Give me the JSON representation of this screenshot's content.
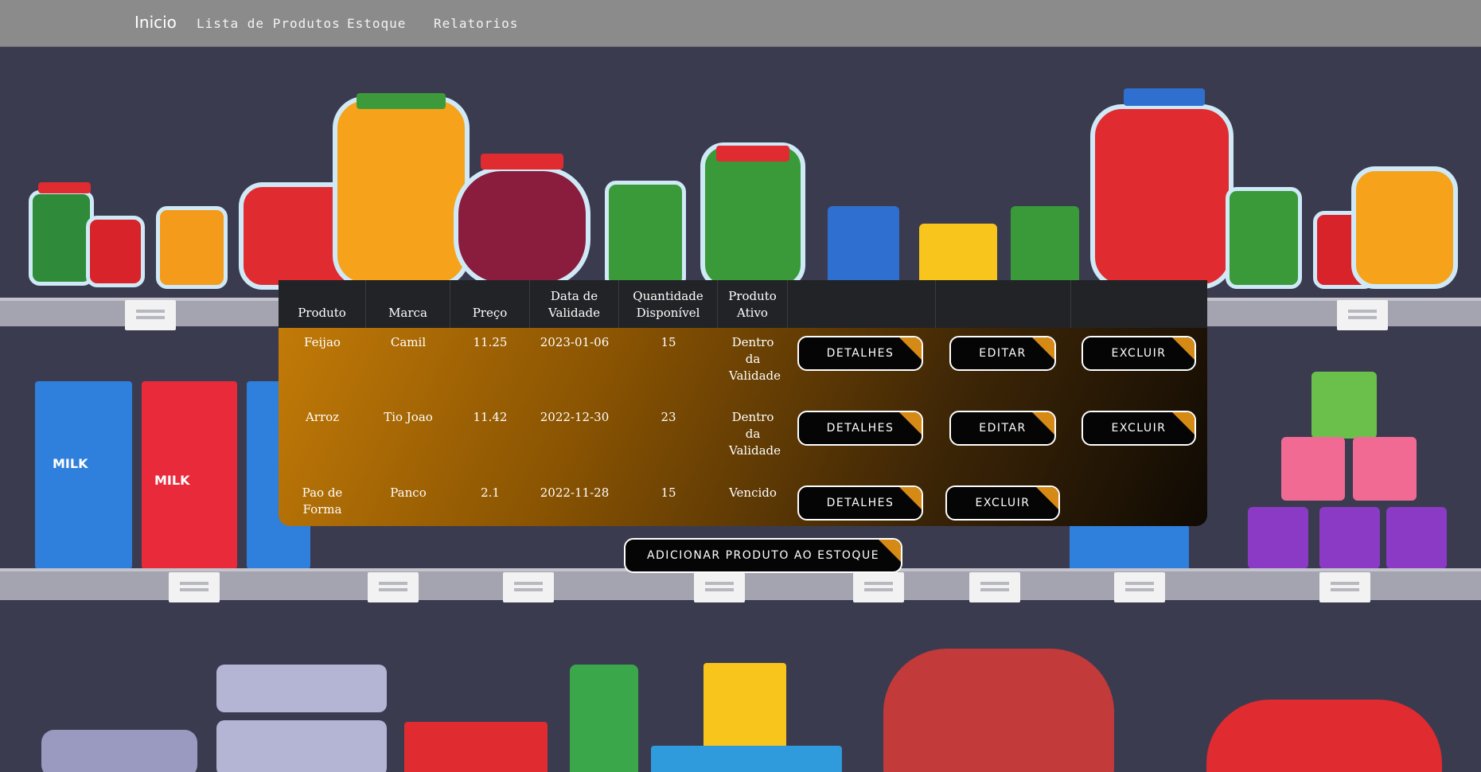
{
  "nav": {
    "brand": "Inicio",
    "links": [
      "Lista de Produtos",
      "Estoque",
      "Relatorios"
    ]
  },
  "table": {
    "headers": [
      "Produto",
      "Marca",
      "Preço",
      "Data de Validade",
      "Quantidade Disponível",
      "Produto Ativo"
    ],
    "rows": [
      {
        "produto": "Feijao",
        "marca": "Camil",
        "preco": "11.25",
        "validade": "2023-01-06",
        "quantidade": "15",
        "status": "Dentro da Validade"
      },
      {
        "produto": "Arroz",
        "marca": "Tio Joao",
        "preco": "11.42",
        "validade": "2022-12-30",
        "quantidade": "23",
        "status": "Dentro da Validade"
      },
      {
        "produto": "Pao de Forma",
        "marca": "Panco",
        "preco": "2.1",
        "validade": "2022-11-28",
        "quantidade": "15",
        "status": "Vencido"
      }
    ],
    "actions": {
      "details": "DETALHES",
      "edit": "EDITAR",
      "delete": "EXCLUIR"
    }
  },
  "add_button": "ADICIONAR PRODUTO AO ESTOQUE",
  "colors": {
    "accent": "#d68a16",
    "navbar": "#8b8b8b"
  }
}
